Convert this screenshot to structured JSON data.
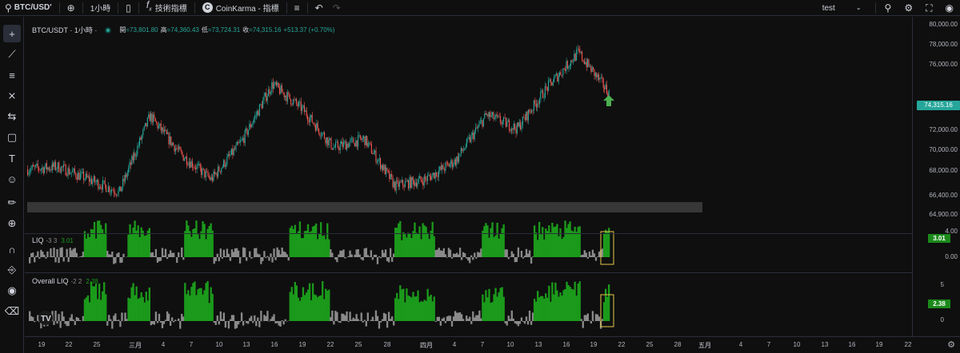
{
  "toolbar": {
    "symbol": "BTC/USD'",
    "interval": "1小時",
    "indicators_label": "技術指標",
    "coinkarma_label": "CoinKarma - 指標",
    "layout_name": "test"
  },
  "main_pane": {
    "title": "BTC/USDT · 1小時 ·",
    "open_label": "開",
    "open_value": "=73,801.80",
    "high_label": "高",
    "high_value": "=74,360.43",
    "low_label": "低",
    "low_value": "=73,724.31",
    "close_label": "收",
    "close_value": "=74,315.16",
    "change": "+513.37 (+0.70%)",
    "current_price": "74,315.16",
    "price_axis": [
      "80,000.00",
      "78,000.00",
      "76,000.00",
      "72,000.00",
      "70,000.00",
      "68,000.00",
      "66,400.00",
      "64,900.00"
    ]
  },
  "liq_pane": {
    "name": "LIQ",
    "params": "-3 3",
    "value": "3.01",
    "axis": [
      "4.00",
      "0.00"
    ]
  },
  "overall_liq_pane": {
    "name": "Overall LIQ",
    "params": "-2 2",
    "value": "2.38",
    "axis": [
      "5",
      "0"
    ]
  },
  "time_axis": [
    "19",
    "22",
    "25",
    "三月",
    "4",
    "7",
    "10",
    "13",
    "16",
    "19",
    "22",
    "25",
    "28",
    "四月",
    "4",
    "7",
    "10",
    "13",
    "16",
    "19",
    "22",
    "25",
    "28",
    "五月",
    "4",
    "7",
    "10",
    "13",
    "16",
    "19",
    "22"
  ],
  "colors": {
    "up": "#26a69a",
    "down": "#ef5350",
    "liq_green": "#1b9a1b",
    "liq_gray": "#8a8a8a",
    "highlight_box": "#e6c84a",
    "arrow": "#4caf50"
  },
  "chart_data": {
    "type": "line",
    "title": "BTC/USDT · 1小時 ·",
    "ylim": [
      64900,
      80000
    ],
    "x": [
      "19",
      "22",
      "25",
      "三月",
      "4",
      "7",
      "10",
      "13",
      "16",
      "19",
      "22",
      "25",
      "28",
      "四月",
      "4",
      "7",
      "10",
      "13",
      "16",
      "19"
    ],
    "series": [
      {
        "name": "BTC/USDT",
        "values": [
          68300,
          68500,
          67500,
          66500,
          72500,
          69500,
          67500,
          70500,
          75000,
          73000,
          70000,
          70700,
          67000,
          67500,
          69000,
          72600,
          71500,
          74800,
          77500,
          74315
        ]
      }
    ]
  }
}
